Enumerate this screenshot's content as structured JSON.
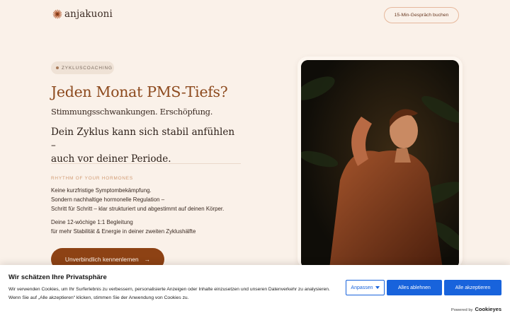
{
  "header": {
    "logo_text": "anjakuoni",
    "cta_label": "15-Min-Gespräch buchen"
  },
  "hero": {
    "pill_label": "ZYKLUSCOACHING",
    "headline": "Jeden Monat PMS-Tiefs?",
    "subline": "Stimmungsschwankungen. Erschöpfung.",
    "promise_line1": "Dein Zyklus kann sich stabil anfühlen –",
    "promise_line2": "auch vor deiner Periode.",
    "eyebrow": "RHYTHM OF YOUR HORMONES",
    "para1_line1": "Keine kurzfristige Symptombekämpfung.",
    "para1_line2": "Sondern nachhaltige hormonelle Regulation –",
    "para1_line3": "Schritt für Schritt – klar strukturiert und abgestimmt auf deinen Körper.",
    "para2_line1": "Deine 12-wöchige 1:1 Begleitung",
    "para2_line2": "für mehr Stabilität & Energie in deiner zweiten Zyklushälfte",
    "button_label": "Unverbindlich kennenlernen",
    "button_arrow": "→"
  },
  "cookie_banner": {
    "title": "Wir schätzen Ihre Privatsphäre",
    "text": "Wir verwenden Cookies, um Ihr Surferlebnis zu verbessern, personalisierte Anzeigen oder Inhalte einzusetzen und unseren Datenverkehr zu analysieren. Wenn Sie auf „Alle akzeptieren“ klicken, stimmen Sie der Anwendung von Cookies zu.",
    "customize_label": "Anpassen",
    "reject_label": "Alles ablehnen",
    "accept_label": "Alle akzeptieren",
    "powered_by": "Powered by",
    "brand": "Cookieyes"
  },
  "colors": {
    "background": "#faf1e9",
    "accent": "#8d4214",
    "headline": "#8d4a1e",
    "cookie_blue": "#1863dc"
  },
  "icons": {
    "logo": "sun-burst-icon",
    "button_arrow": "arrow-right-icon",
    "customize_caret": "caret-down-icon"
  }
}
